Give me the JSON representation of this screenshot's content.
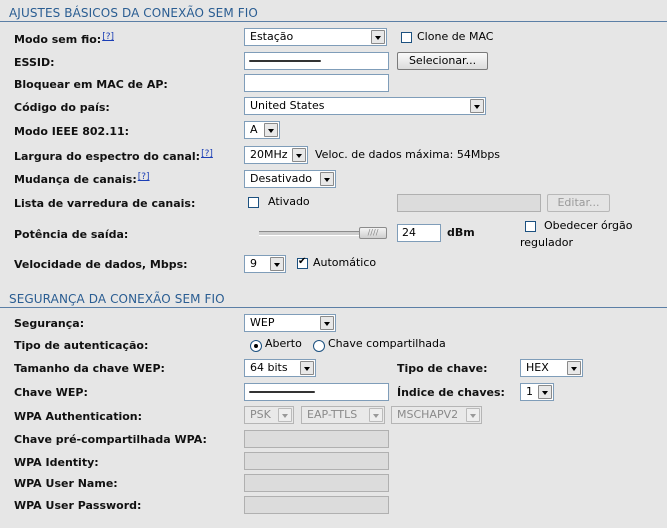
{
  "wireless_basic": {
    "title": "AJUSTES BÁSICOS DA CONEXÃO SEM FIO",
    "wireless_mode": {
      "label": "Modo sem fio:",
      "help": "[?]",
      "value": "Estação"
    },
    "mac_clone": {
      "label": "Clone de MAC",
      "checked": false
    },
    "essid": {
      "label": "ESSID:",
      "value": ""
    },
    "select_button": "Selecionar...",
    "lock_ap_mac": {
      "label": "Bloquear em MAC de AP:",
      "value": ""
    },
    "country_code": {
      "label": "Código do país:",
      "value": "United States"
    },
    "ieee_mode": {
      "label": "Modo IEEE 802.11:",
      "value": "A"
    },
    "channel_width": {
      "label": "Largura do espectro do canal:",
      "help": "[?]",
      "value": "20MHz",
      "note": "Veloc. de dados máxima: 54Mbps"
    },
    "channel_shifting": {
      "label": "Mudança de canais:",
      "help": "[?]",
      "value": "Desativado"
    },
    "channel_scan_list": {
      "label": "Lista de varredura de canais:",
      "checkbox_label": "Ativado",
      "checked": false,
      "edit_button": "Editar..."
    },
    "output_power": {
      "label": "Potência de saída:",
      "value": "24",
      "unit": "dBm",
      "regulatory_label_1": "Obedecer órgão",
      "regulatory_label_2": "regulador",
      "regulatory_checked": false
    },
    "data_rate": {
      "label": "Velocidade de dados, Mbps:",
      "value": "9",
      "auto_label": "Automático",
      "auto_checked": true
    }
  },
  "wireless_security": {
    "title": "SEGURANÇA DA CONEXÃO SEM FIO",
    "security": {
      "label": "Segurança:",
      "value": "WEP"
    },
    "auth_type": {
      "label": "Tipo de autenticação:",
      "option_open": "Aberto",
      "option_shared": "Chave compartilhada",
      "selected": "open"
    },
    "wep_key_length": {
      "label": "Tamanho da chave WEP:",
      "value": "64 bits"
    },
    "key_type": {
      "label": "Tipo de chave:",
      "value": "HEX"
    },
    "wep_key": {
      "label": "Chave WEP:",
      "value": ""
    },
    "key_index": {
      "label": "Índice de chaves:",
      "value": "1"
    },
    "wpa_auth": {
      "label": "WPA Authentication:",
      "opt1": "PSK",
      "opt2": "EAP-TTLS",
      "opt3": "MSCHAPV2"
    },
    "wpa_psk": {
      "label": "Chave pré-compartilhada WPA:"
    },
    "wpa_identity": {
      "label": "WPA Identity:"
    },
    "wpa_user_name": {
      "label": "WPA User Name:"
    },
    "wpa_user_password": {
      "label": "WPA User Password:"
    }
  }
}
